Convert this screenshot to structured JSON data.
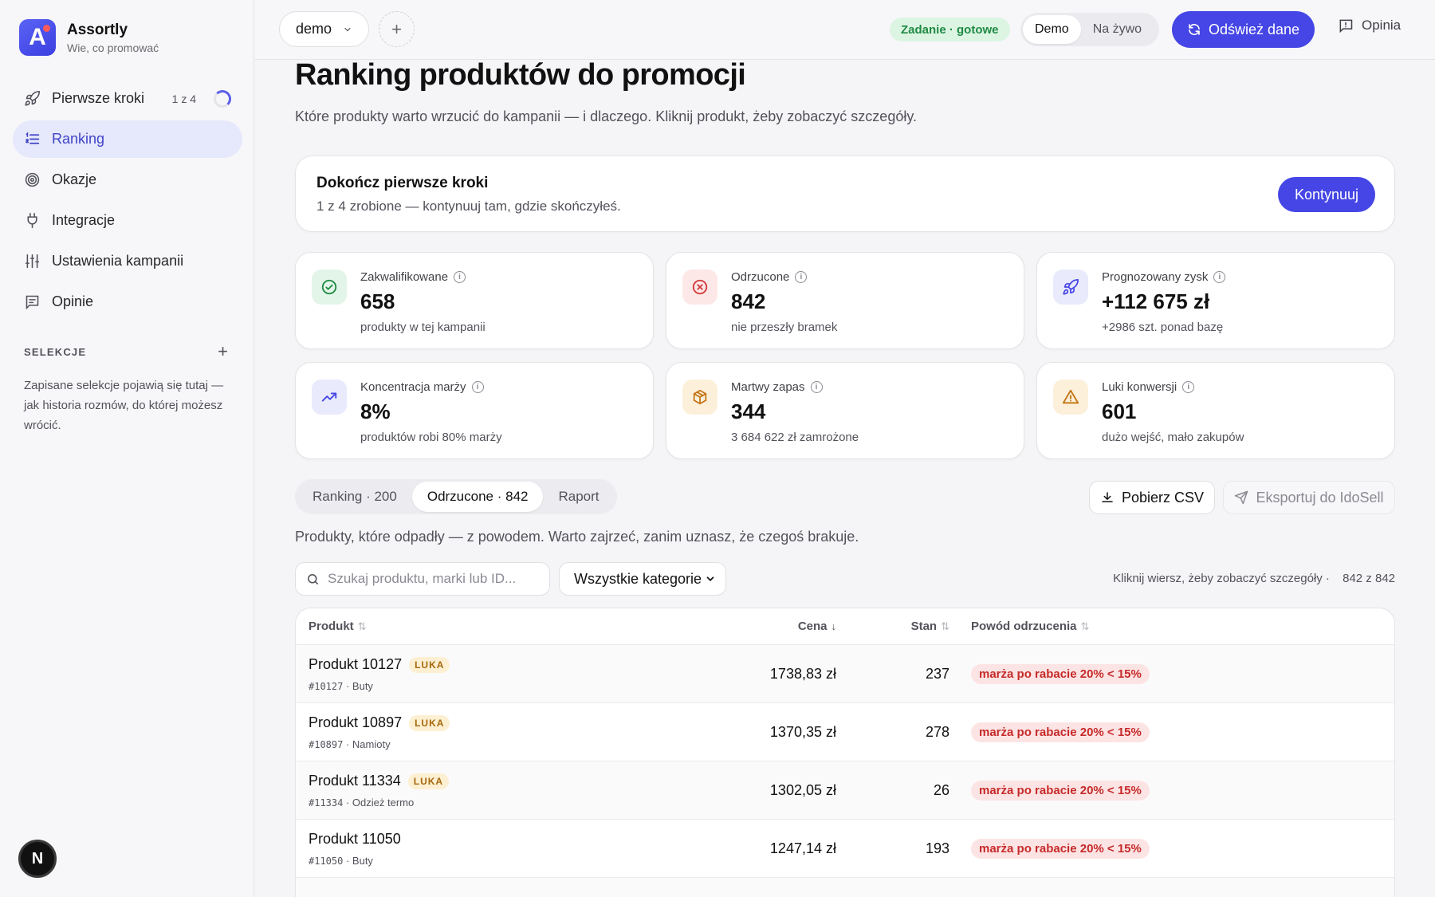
{
  "brand": {
    "name": "Assortly",
    "tagline": "Wie, co promować",
    "logo_letter": "A"
  },
  "sidebar": {
    "items": [
      {
        "label": "Pierwsze kroki",
        "icon": "rocket-icon",
        "progress": "1 z 4"
      },
      {
        "label": "Ranking",
        "icon": "list-icon",
        "active": true
      },
      {
        "label": "Okazje",
        "icon": "target-icon"
      },
      {
        "label": "Integracje",
        "icon": "plug-icon"
      },
      {
        "label": "Ustawienia kampanii",
        "icon": "sliders-icon"
      },
      {
        "label": "Opinie",
        "icon": "message-icon"
      }
    ],
    "selections_title": "SELEKCJE",
    "selections_note": "Zapisane selekcje pojawią się tutaj — jak historia rozmów, do której możesz wrócić.",
    "avatar_letter": "N"
  },
  "topbar": {
    "workspace": "demo",
    "job_status": "Zadanie · gotowe",
    "mode_demo": "Demo",
    "mode_live": "Na żywo",
    "refresh_label": "Odśwież dane",
    "feedback_label": "Opinia"
  },
  "page": {
    "title": "Ranking produktów do promocji",
    "subtitle": "Które produkty warto wrzucić do kampanii — i dlaczego. Kliknij produkt, żeby zobaczyć szczegóły."
  },
  "onboarding": {
    "title": "Dokończ pierwsze kroki",
    "subtitle": "1 z 4 zrobione — kontynuuj tam, gdzie skończyłeś.",
    "button": "Kontynuuj"
  },
  "kpis": [
    {
      "label": "Zakwalifikowane",
      "value": "658",
      "sub": "produkty w tej kampanii",
      "icon": "check-circle-icon",
      "color": "#1f8a43",
      "bg": "#e3f5e9"
    },
    {
      "label": "Odrzucone",
      "value": "842",
      "sub": "nie przeszły bramek",
      "icon": "x-circle-icon",
      "color": "#d23a3a",
      "bg": "#fde8e8"
    },
    {
      "label": "Prognozowany zysk",
      "value": "+112 675 zł",
      "sub": "+2986 szt. ponad bazę",
      "icon": "rocket-icon",
      "color": "#4546e5",
      "bg": "#e9eafc"
    },
    {
      "label": "Koncentracja marży",
      "value": "8%",
      "sub": "produktów robi 80% marży",
      "icon": "trend-up-icon",
      "color": "#4546e5",
      "bg": "#e9eafc"
    },
    {
      "label": "Martwy zapas",
      "value": "344",
      "sub": "3 684 622 zł zamrożone",
      "icon": "package-icon",
      "color": "#c27313",
      "bg": "#fdf0da"
    },
    {
      "label": "Luki konwersji",
      "value": "601",
      "sub": "dużo wejść, mało zakupów",
      "icon": "warning-icon",
      "color": "#c27313",
      "bg": "#fdf0da"
    }
  ],
  "tabs": [
    {
      "label": "Ranking · 200"
    },
    {
      "label": "Odrzucone · 842",
      "active": true
    },
    {
      "label": "Raport"
    }
  ],
  "actions": {
    "csv": "Pobierz CSV",
    "export": "Eksportuj do IdoSell"
  },
  "list_description": "Produkty, które odpadły — z powodem. Warto zajrzeć, zanim uznasz, że czegoś brakuje.",
  "filters": {
    "search_placeholder": "Szukaj produktu, marki lub ID...",
    "category": "Wszystkie kategorie",
    "hint": "Kliknij wiersz, żeby zobaczyć szczegóły ·",
    "count": "842 z 842"
  },
  "table": {
    "columns": [
      "Produkt",
      "Cena",
      "Stan",
      "Powód odrzucenia"
    ],
    "badge_label": "LUKA",
    "rows": [
      {
        "name": "Produkt 10127",
        "badge": true,
        "id": "#10127",
        "category": "Buty",
        "price": "1738,83 zł",
        "stock": "237",
        "reason": "marża po rabacie 20% < 15%"
      },
      {
        "name": "Produkt 10897",
        "badge": true,
        "id": "#10897",
        "category": "Namioty",
        "price": "1370,35 zł",
        "stock": "278",
        "reason": "marża po rabacie 20% < 15%"
      },
      {
        "name": "Produkt 11334",
        "badge": true,
        "id": "#11334",
        "category": "Odzież termo",
        "price": "1302,05 zł",
        "stock": "26",
        "reason": "marża po rabacie 20% < 15%"
      },
      {
        "name": "Produkt 11050",
        "badge": false,
        "id": "#11050",
        "category": "Buty",
        "price": "1247,14 zł",
        "stock": "193",
        "reason": "marża po rabacie 20% < 15%"
      }
    ]
  }
}
